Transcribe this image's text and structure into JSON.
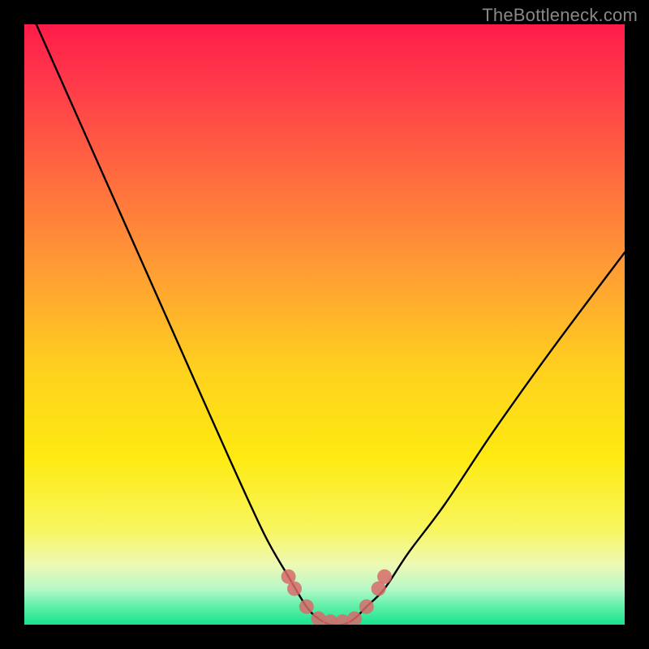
{
  "watermark": "TheBottleneck.com",
  "chart_data": {
    "type": "line",
    "title": "",
    "xlabel": "",
    "ylabel": "",
    "xlim": [
      0,
      100
    ],
    "ylim": [
      0,
      100
    ],
    "grid": false,
    "legend": false,
    "series": [
      {
        "name": "bottleneck-curve",
        "x": [
          2,
          10,
          18,
          26,
          34,
          40,
          44,
          47,
          49,
          51,
          53,
          55,
          57,
          60,
          64,
          70,
          78,
          88,
          100
        ],
        "y": [
          100,
          82,
          64,
          46,
          28,
          15,
          8,
          3,
          1,
          0,
          0,
          1,
          3,
          6,
          12,
          20,
          32,
          46,
          62
        ]
      }
    ],
    "markers": {
      "name": "bottleneck-dots",
      "points": [
        {
          "x": 44,
          "y": 8
        },
        {
          "x": 45,
          "y": 6
        },
        {
          "x": 47,
          "y": 3
        },
        {
          "x": 49,
          "y": 1
        },
        {
          "x": 51,
          "y": 0.5
        },
        {
          "x": 53,
          "y": 0.5
        },
        {
          "x": 55,
          "y": 1
        },
        {
          "x": 57,
          "y": 3
        },
        {
          "x": 59,
          "y": 6
        },
        {
          "x": 60,
          "y": 8
        }
      ]
    },
    "gradient_stops": [
      {
        "pos": 0,
        "color": "#ff1c4a"
      },
      {
        "pos": 10,
        "color": "#ff3a4a"
      },
      {
        "pos": 25,
        "color": "#ff6a3f"
      },
      {
        "pos": 40,
        "color": "#ff9a35"
      },
      {
        "pos": 58,
        "color": "#ffd21e"
      },
      {
        "pos": 72,
        "color": "#feea11"
      },
      {
        "pos": 84,
        "color": "#f8f65e"
      },
      {
        "pos": 90,
        "color": "#eef9b4"
      },
      {
        "pos": 94,
        "color": "#b8f8c8"
      },
      {
        "pos": 97,
        "color": "#5ef0a8"
      },
      {
        "pos": 100,
        "color": "#17e38e"
      }
    ]
  }
}
